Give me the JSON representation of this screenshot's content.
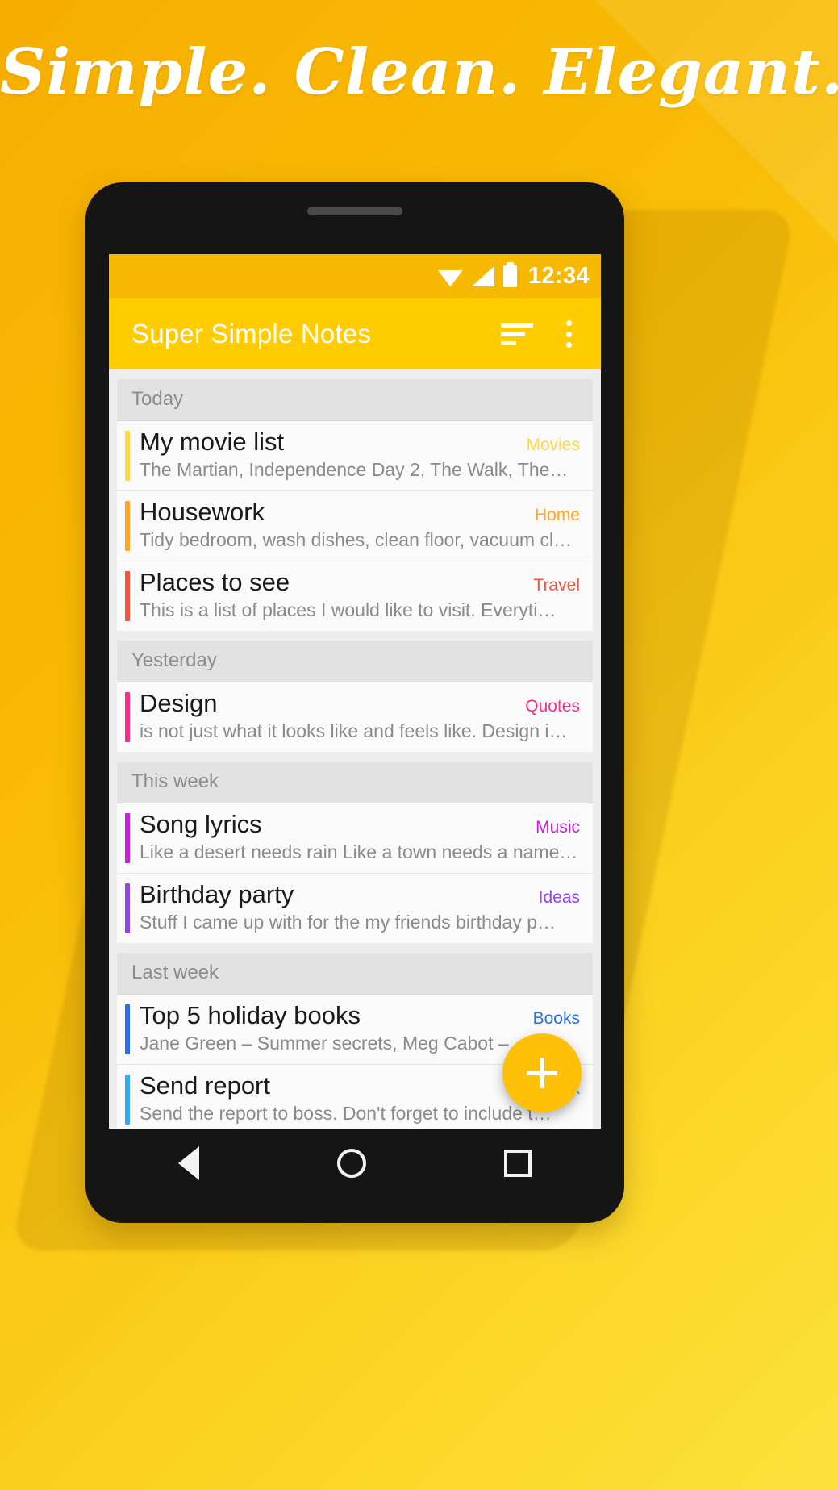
{
  "headline": "Simple. Clean. Elegant.",
  "theme": {
    "brand_yellow": "#FFCC00",
    "status_yellow": "#F6B800",
    "fab_yellow": "#FFC107",
    "background_yellow": "#F5B400"
  },
  "statusbar": {
    "clock": "12:34",
    "icons": [
      "wifi-icon",
      "signal-icon",
      "battery-icon"
    ]
  },
  "appbar": {
    "title": "Super Simple Notes",
    "sort_icon": "sort-icon",
    "overflow_icon": "overflow-menu-icon"
  },
  "fab": {
    "icon": "plus-icon",
    "label": "+"
  },
  "navbar": {
    "back": "back-triangle-icon",
    "home": "home-circle-icon",
    "recents": "recents-square-icon"
  },
  "sections": [
    {
      "header": "Today",
      "notes": [
        {
          "title": "My movie list",
          "category": "Movies",
          "color": "#FFD740",
          "snippet": "The Martian, Independence Day 2, The Walk, The…"
        },
        {
          "title": "Housework",
          "category": "Home",
          "color": "#FFA726",
          "snippet": "Tidy bedroom, wash dishes, clean floor, vacuum cl…"
        },
        {
          "title": "Places to see",
          "category": "Travel",
          "color": "#F4533C",
          "snippet": "This is a list of places I would like to visit. Everyti…"
        }
      ]
    },
    {
      "header": "Yesterday",
      "notes": [
        {
          "title": "Design",
          "category": "Quotes",
          "color": "#F5308C",
          "snippet": "is not just what it looks like and feels like. Design i…"
        }
      ]
    },
    {
      "header": "This week",
      "notes": [
        {
          "title": "Song lyrics",
          "category": "Music",
          "color": "#C820D8",
          "snippet": "Like a desert needs rain Like a town needs a name…"
        },
        {
          "title": "Birthday party",
          "category": "Ideas",
          "color": "#9147E0",
          "snippet": "Stuff I came up with for the my friends birthday p…"
        }
      ]
    },
    {
      "header": "Last week",
      "notes": [
        {
          "title": "Top 5 holiday books",
          "category": "Books",
          "color": "#2B6FE8",
          "snippet": "Jane Green – Summer secrets, Meg Cabot –…"
        },
        {
          "title": "Send report",
          "category": "Work",
          "color": "#34A9F0",
          "snippet": "Send the report to boss. Don't forget to include t…"
        }
      ]
    }
  ]
}
